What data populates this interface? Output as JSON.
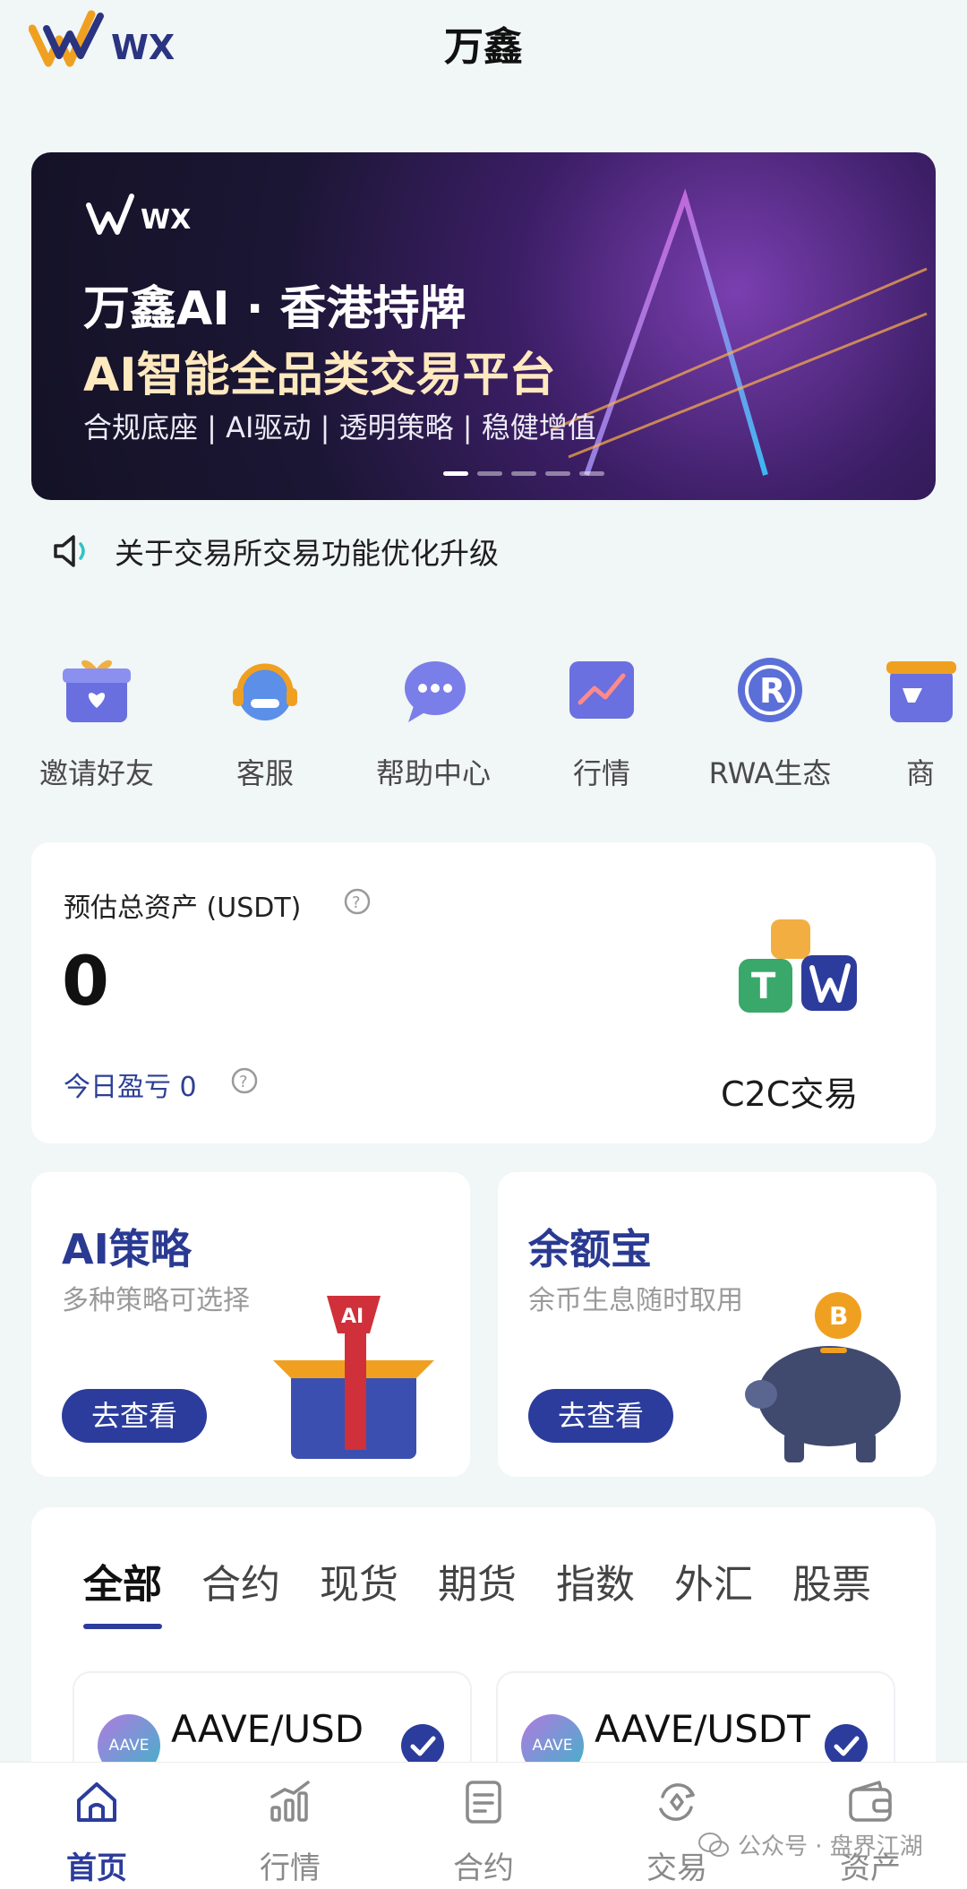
{
  "app": {
    "title": "万鑫",
    "logo_text": "WWX"
  },
  "banner": {
    "logo_text": "WWX",
    "title_line1": "万鑫AI · 香港持牌",
    "title_line2": "AI智能全品类交易平台",
    "subtitle": "合规底座 | AI驱动 | 透明策略 | 稳健增值",
    "dot_count": 5,
    "active_dot": 0
  },
  "notice": {
    "icon": "speaker-icon",
    "text": "关于交易所交易功能优化升级"
  },
  "shortcuts": [
    {
      "label": "邀请好友",
      "icon": "gift-icon"
    },
    {
      "label": "客服",
      "icon": "headset-icon"
    },
    {
      "label": "帮助中心",
      "icon": "chat-bubble-icon"
    },
    {
      "label": "行情",
      "icon": "chart-icon"
    },
    {
      "label": "RWA生态",
      "icon": "rwa-icon"
    },
    {
      "label": "商",
      "icon": "shop-icon"
    }
  ],
  "assets": {
    "label": "预估总资产 (USDT)",
    "value": "0",
    "pnl_label": "今日盈亏 0",
    "c2c_label": "C2C交易"
  },
  "products": [
    {
      "title": "AI策略",
      "subtitle": "多种策略可选择",
      "button": "去查看",
      "illustration": "ai-box-icon"
    },
    {
      "title": "余额宝",
      "subtitle": "余币生息随时取用",
      "button": "去查看",
      "illustration": "piggy-bank-icon"
    }
  ],
  "market": {
    "tabs": [
      "全部",
      "合约",
      "现货",
      "期货",
      "指数",
      "外汇",
      "股票"
    ],
    "active_tab": 0,
    "pairs": [
      {
        "coin": "AAVE",
        "pair": "AAVE/USD",
        "selected": true
      },
      {
        "coin": "AAVE",
        "pair": "AAVE/USDT",
        "selected": true
      }
    ]
  },
  "bottom_nav": [
    {
      "label": "首页",
      "icon": "home-icon",
      "active": true
    },
    {
      "label": "行情",
      "icon": "market-chart-icon",
      "active": false
    },
    {
      "label": "合约",
      "icon": "contract-doc-icon",
      "active": false
    },
    {
      "label": "交易",
      "icon": "trade-exchange-icon",
      "active": false
    },
    {
      "label": "资产",
      "icon": "wallet-icon",
      "active": false
    }
  ],
  "watermark": "公众号 · 盘界江湖",
  "colors": {
    "brand_blue": "#2c3c9c",
    "brand_orange": "#f0a020",
    "page_bg": "#f1f6f6"
  }
}
